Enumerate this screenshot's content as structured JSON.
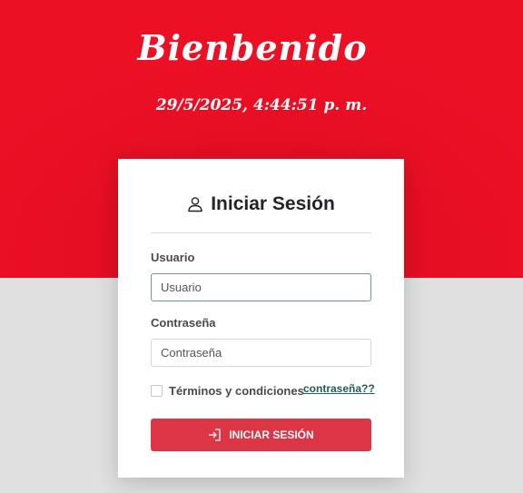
{
  "header": {
    "welcome": "Bienbenido",
    "datetime": "29/5/2025, 4:44:51 p. m.",
    "background_color": "#ec1025"
  },
  "login": {
    "title": "Iniciar Sesión",
    "title_icon": "user-icon",
    "username": {
      "label": "Usuario",
      "placeholder": "Usuario",
      "value": ""
    },
    "password": {
      "label": "Contraseña",
      "placeholder": "Contraseña",
      "value": ""
    },
    "terms": {
      "label": "Términos y condiciones",
      "checked": false
    },
    "forgot_link": "contraseña??",
    "submit": {
      "label": "INICIAR SESIÓN",
      "icon": "sign-in-icon",
      "color": "#dc3545"
    }
  }
}
